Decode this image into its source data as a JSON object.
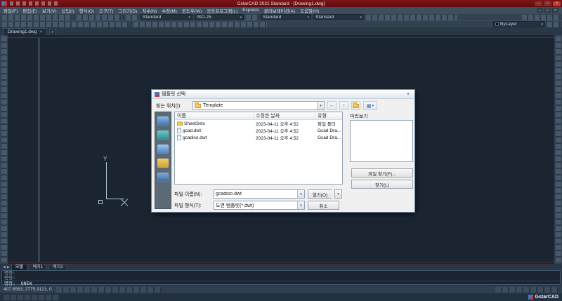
{
  "window": {
    "title": "GstarCAD 2021 Standard - [Drawing1.dwg]"
  },
  "icons": {
    "min": "–",
    "max": "□",
    "close": "×",
    "dropdown": "▾",
    "back": "←",
    "up": "↑",
    "views": "▦",
    "tab_prev": "◀",
    "tab_next": "▶",
    "plus": "+"
  },
  "menu": {
    "items": [
      "파일(F)",
      "편집(E)",
      "보기(V)",
      "삽입(I)",
      "형식(O)",
      "도구(T)",
      "그리기(D)",
      "치수(N)",
      "수정(M)",
      "윈도우(W)",
      "응용프로그램(L)",
      "Express",
      "콜라보레이션(A)",
      "도움말(H)"
    ]
  },
  "toolbar": {
    "style_combo": "Standard",
    "dim_combo": "ISO-25",
    "text_combo": "Standard",
    "table_combo": "Standard",
    "color_combo": "ByLayer"
  },
  "doc_tab": {
    "label": "Drawing1.dwg"
  },
  "canvas": {
    "ucs_y": "Y"
  },
  "dialog": {
    "title": "템플릿 선택",
    "look_in_label": "찾는 위치(I):",
    "look_in_value": "Template",
    "preview_label": "미리보기",
    "columns": {
      "name": "이름",
      "date": "수정한 날짜",
      "type": "유형"
    },
    "files": [
      {
        "name": "SheetSets",
        "date": "2023-04-11 오후 4:52",
        "type": "파일 폴더"
      },
      {
        "name": "gcad.dwt",
        "date": "2023-04-11 오후 4:52",
        "type": "Gcad Dra..."
      },
      {
        "name": "gcadiso.dwt",
        "date": "2023-04-11 오후 4:52",
        "type": "Gcad Dra..."
      }
    ],
    "file_name_label": "파일 이름(N):",
    "file_name_value": "gcadiso.dwt",
    "file_type_label": "파일 형식(T):",
    "file_type_value": "도면 템플릿(*.dwt)",
    "open_button": "열기(O)",
    "cancel_button": "취소",
    "find_file_button": "파일 찾기(F)...",
    "locate_button": "찾기(L)"
  },
  "layout": {
    "tabs": [
      "모델",
      "배치1",
      "배치2"
    ]
  },
  "command": {
    "history": [
      "명령:",
      "명령:"
    ],
    "input": "명령: _QNEW"
  },
  "status": {
    "coords": "407.8563, 2775.9121, 0",
    "brand": "GstarCAD"
  }
}
